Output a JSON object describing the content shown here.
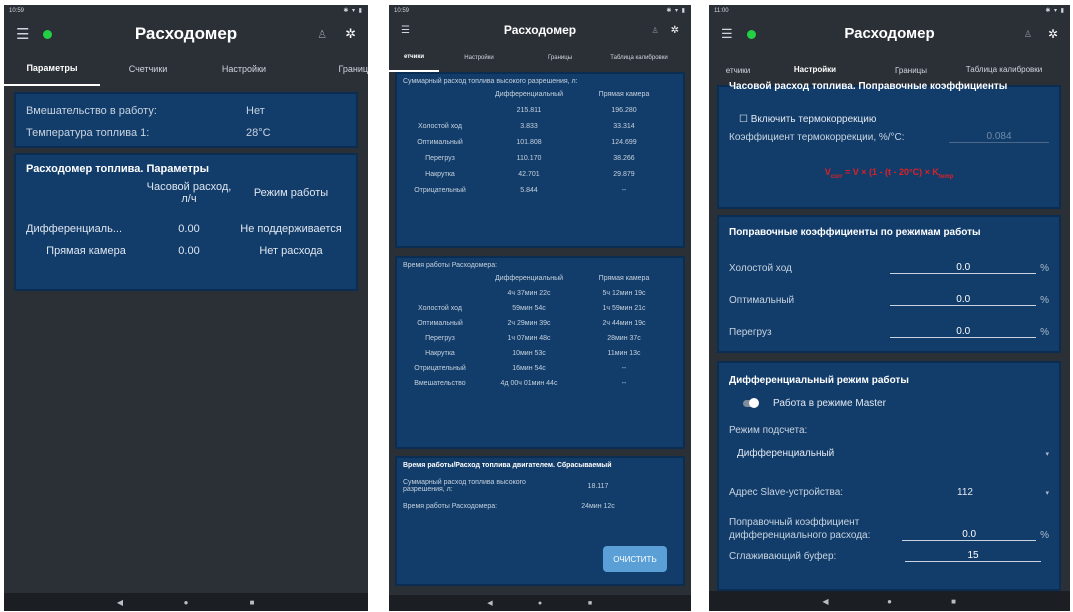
{
  "app": {
    "title": "Расходомер",
    "icons": {
      "menu": "menu-icon",
      "status_dot": "connection-status-dot",
      "person": "person-icon",
      "settings": "gear-icon"
    },
    "colors": {
      "background": "#2b3036",
      "panel": "#123d6b",
      "status_dot": "#22d043",
      "accent_button": "#5aa0d6",
      "formula": "#e01f25"
    }
  },
  "screen1": {
    "status_time": "10:59",
    "tabs": [
      "Параметры",
      "Счетчики",
      "Настройки",
      "Границ"
    ],
    "active_tab": "Параметры",
    "info": {
      "interference_label": "Вмешательство в работу:",
      "interference_value": "Нет",
      "fuel_temp_label": "Температура топлива 1:",
      "fuel_temp_value": "28°C"
    },
    "params": {
      "title": "Расходомер топлива. Параметры",
      "col_hourly": "Часовой расход, л/ч",
      "col_mode": "Режим работы",
      "rows": [
        {
          "name": "Дифференциаль...",
          "hourly": "0.00",
          "mode": "Не поддерживается"
        },
        {
          "name": "Прямая камера",
          "hourly": "0.00",
          "mode": "Нет расхода"
        }
      ]
    },
    "nav": [
      "◀",
      "●",
      "■"
    ]
  },
  "screen2": {
    "status_time": "10:59",
    "tabs": [
      "етчики",
      "Настройки",
      "Границы",
      "Таблица калибровки"
    ],
    "active_tab": "етчики",
    "total_fuel": {
      "title": "Суммарный расход топлива высокого разрешения, л:",
      "col_diff": "Дифференциальный",
      "col_direct": "Прямая камера",
      "rows": [
        {
          "name": "",
          "diff": "215.811",
          "direct": "196.280"
        },
        {
          "name": "Холостой ход",
          "diff": "3.833",
          "direct": "33.314"
        },
        {
          "name": "Оптимальный",
          "diff": "101.808",
          "direct": "124.699"
        },
        {
          "name": "Перегруз",
          "diff": "110.170",
          "direct": "38.266"
        },
        {
          "name": "Накрутка",
          "diff": "42.701",
          "direct": "29.879"
        },
        {
          "name": "Отрицательный",
          "diff": "5.844",
          "direct": "--"
        }
      ]
    },
    "work_time": {
      "title": "Время работы Расходомера:",
      "col_diff": "Дифференциальный",
      "col_direct": "Прямая камера",
      "rows": [
        {
          "name": "",
          "diff": "4ч 37мин 22с",
          "direct": "5ч 12мин 19с"
        },
        {
          "name": "Холостой ход",
          "diff": "59мин 54с",
          "direct": "1ч 59мин 21с"
        },
        {
          "name": "Оптимальный",
          "diff": "2ч 29мин 39с",
          "direct": "2ч 44мин 19с"
        },
        {
          "name": "Перегруз",
          "diff": "1ч 07мин 48с",
          "direct": "28мин 37с"
        },
        {
          "name": "Накрутка",
          "diff": "10мин 53с",
          "direct": "11мин 13с"
        },
        {
          "name": "Отрицательный",
          "diff": "16мин 54с",
          "direct": "--"
        },
        {
          "name": "Вмешательство",
          "diff": "4д 00ч 01мин 44с",
          "direct": "--"
        }
      ]
    },
    "resettable": {
      "title": "Время работы/Расход топлива двигателем. Сбрасываемый",
      "fuel_label": "Суммарный расход топлива высокого разрешения, л:",
      "fuel_value": "18.117",
      "time_label": "Время работы Расходомера:",
      "time_value": "24мин 12с",
      "clear_button": "ОЧИСТИТЬ"
    },
    "nav": [
      "◀",
      "●",
      "■"
    ]
  },
  "screen3": {
    "status_time": "11:00",
    "tabs": [
      "етчики",
      "Настройки",
      "Границы",
      "Таблица калибровки"
    ],
    "active_tab": "Настройки",
    "thermo": {
      "title": "Часовой расход топлива. Поправочные коэффициенты",
      "checkbox_label": "☐ Включить термокоррекцию",
      "checkbox_checked": false,
      "coef_label": "Коэффициент термокоррекции, %/°C:",
      "coef_value": "0.084",
      "formula": {
        "v": "V",
        "corr": "corr",
        "rest": " = V × (1 - (t - 20°C) × K",
        "temp": "temp"
      }
    },
    "mode_coefs": {
      "title": "Поправочные коэффициенты по режимам работы",
      "rows": [
        {
          "label": "Холостой ход",
          "value": "0.0",
          "unit": "%"
        },
        {
          "label": "Оптимальный",
          "value": "0.0",
          "unit": "%"
        },
        {
          "label": "Перегруз",
          "value": "0.0",
          "unit": "%"
        }
      ]
    },
    "diff_mode": {
      "title": "Дифференциальный режим работы",
      "master_label": "Работа в режиме Master",
      "master_on": true,
      "count_mode_label": "Режим подсчета:",
      "count_mode_value": "Дифференциальный",
      "slave_label": "Адрес Slave-устройства:",
      "slave_value": "112",
      "diff_coef_label": "Поправочный коэффициент дифференциального расхода:",
      "diff_coef_value": "0.0",
      "diff_coef_unit": "%",
      "buffer_label": "Сглаживающий буфер:",
      "buffer_value": "15"
    },
    "nav": [
      "◀",
      "●",
      "■"
    ]
  }
}
